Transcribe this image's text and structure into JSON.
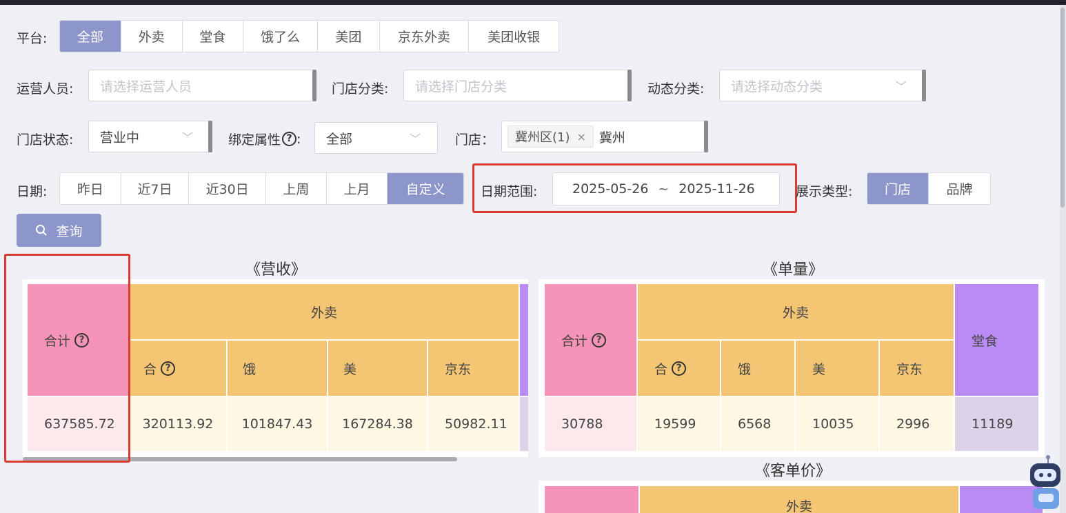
{
  "filters": {
    "platform_label": "平台:",
    "platform_options": [
      "全部",
      "外卖",
      "堂食",
      "饿了么",
      "美团",
      "京东外卖",
      "美团收银"
    ],
    "operator_label": "运营人员:",
    "operator_placeholder": "请选择运营人员",
    "store_category_label": "门店分类:",
    "store_category_placeholder": "请选择门店分类",
    "dynamic_category_label": "动态分类:",
    "dynamic_category_placeholder": "请选择动态分类",
    "store_status_label": "门店状态:",
    "store_status_value": "营业中",
    "binding_label": "绑定属性",
    "binding_value": "全部",
    "store_label": "门店：",
    "store_tag": "冀州区(1)",
    "store_input": "冀州",
    "date_label": "日期:",
    "date_options": [
      "昨日",
      "近7日",
      "近30日",
      "上周",
      "上月",
      "自定义"
    ],
    "date_range_label": "日期范围:",
    "date_start": "2025-05-26",
    "date_sep": "~",
    "date_end": "2025-11-26",
    "display_type_label": "展示类型:",
    "display_type_options": [
      "门店",
      "品牌"
    ],
    "query_button": "查询"
  },
  "revenue": {
    "title": "《营收》",
    "total_header": "合计",
    "group_header": "外卖",
    "sub_headers": [
      "合",
      "饿",
      "美",
      "京东"
    ],
    "total_value": "637585.72",
    "values": [
      "320113.92",
      "101847.43",
      "167284.38",
      "50982.11"
    ]
  },
  "orders": {
    "title": "《单量》",
    "total_header": "合计",
    "group_header": "外卖",
    "sub_headers": [
      "合",
      "饿",
      "美",
      "京东"
    ],
    "dine_header": "堂食",
    "total_value": "30788",
    "values": [
      "19599",
      "6568",
      "10035",
      "2996"
    ],
    "dine_value": "11189"
  },
  "avg_price": {
    "title": "《客单价》",
    "group_header": "外卖"
  },
  "colors": {
    "accent": "#8c96ca",
    "total_header": "#f594b8",
    "total_cell": "#fbe9ec",
    "takeout_header": "#f4c573",
    "takeout_cell": "#fdf7e4",
    "dine_header": "#b98bf3",
    "dine_cell": "#ddd3e8",
    "highlight": "#d83b2f"
  }
}
